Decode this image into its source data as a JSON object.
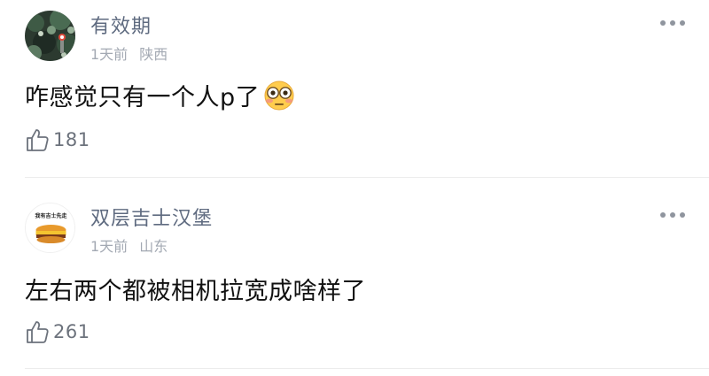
{
  "comments": [
    {
      "username": "有效期",
      "time": "1天前",
      "location": "陕西",
      "text": "咋感觉只有一个人p了",
      "emoji": "flushed-face",
      "likes": "181"
    },
    {
      "username": "双层吉士汉堡",
      "time": "1天前",
      "location": "山东",
      "avatar_caption": "我有吉士先走",
      "text": "左右两个都被相机拉宽成啥样了",
      "likes": "261"
    }
  ],
  "colors": {
    "username": "#5f6b80",
    "meta": "#a3a9b3",
    "text": "#111111",
    "icon": "#6c727c",
    "divider": "#ececec"
  }
}
